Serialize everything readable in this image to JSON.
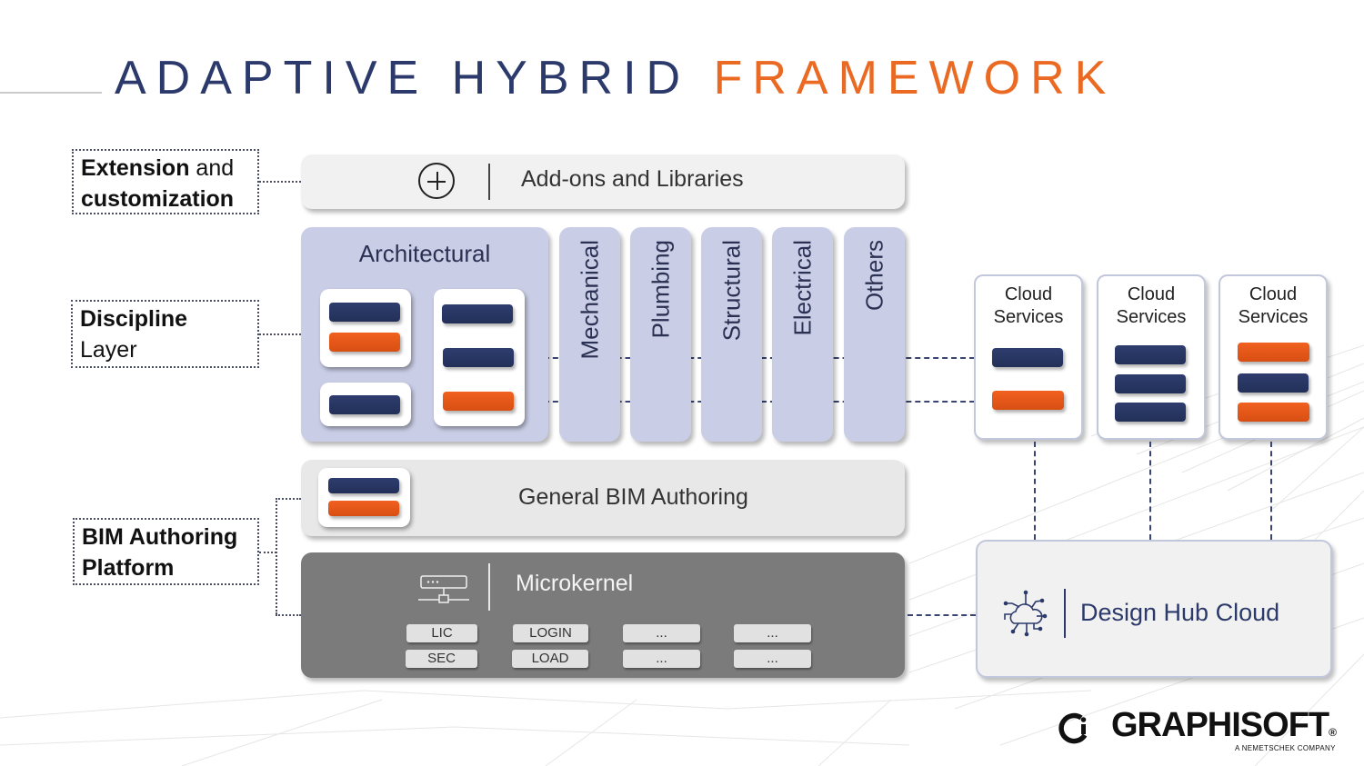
{
  "title": {
    "part1": "ADAPTIVE HYBRID",
    "part2": "FRAMEWORK",
    "colors": {
      "primary": "#2b3a6b",
      "accent": "#ea6a23"
    }
  },
  "left_labels": [
    {
      "bold": "Extension",
      "rest": " and",
      "line2_bold": "customization",
      "line2": ""
    },
    {
      "bold": "Discipline",
      "rest": "",
      "line2_bold": "",
      "line2": "Layer"
    },
    {
      "bold": "BIM Authoring",
      "rest": "",
      "line2_bold": "Platform",
      "line2": ""
    }
  ],
  "addons": {
    "icon": "plus-circle-icon",
    "label": "Add-ons and Libraries"
  },
  "disciplines": {
    "architectural": "Architectural",
    "columns": [
      "Mechanical",
      "Plumbing",
      "Structural",
      "Electrical",
      "Others"
    ]
  },
  "cloud_services": [
    {
      "title_line1": "Cloud",
      "title_line2": "Services",
      "modules": [
        "navy",
        "orange"
      ]
    },
    {
      "title_line1": "Cloud",
      "title_line2": "Services",
      "modules": [
        "navy",
        "navy",
        "navy"
      ]
    },
    {
      "title_line1": "Cloud",
      "title_line2": "Services",
      "modules": [
        "orange",
        "navy",
        "orange"
      ]
    }
  ],
  "general_bim": {
    "label": "General BIM Authoring"
  },
  "microkernel": {
    "icon": "server-network-icon",
    "label": "Microkernel",
    "chips": [
      [
        "LIC",
        "SEC"
      ],
      [
        "LOGIN",
        "LOAD"
      ],
      [
        "...",
        "..."
      ],
      [
        "...",
        "..."
      ]
    ]
  },
  "design_hub": {
    "icon": "cloud-network-icon",
    "label": "Design Hub Cloud"
  },
  "logo": {
    "name": "GRAPHISOFT",
    "registered": "®",
    "tagline": "A NEMETSCHEK COMPANY"
  },
  "palette": {
    "navy": "#27355f",
    "orange": "#e85a18",
    "lavender": "#c9cde5"
  }
}
